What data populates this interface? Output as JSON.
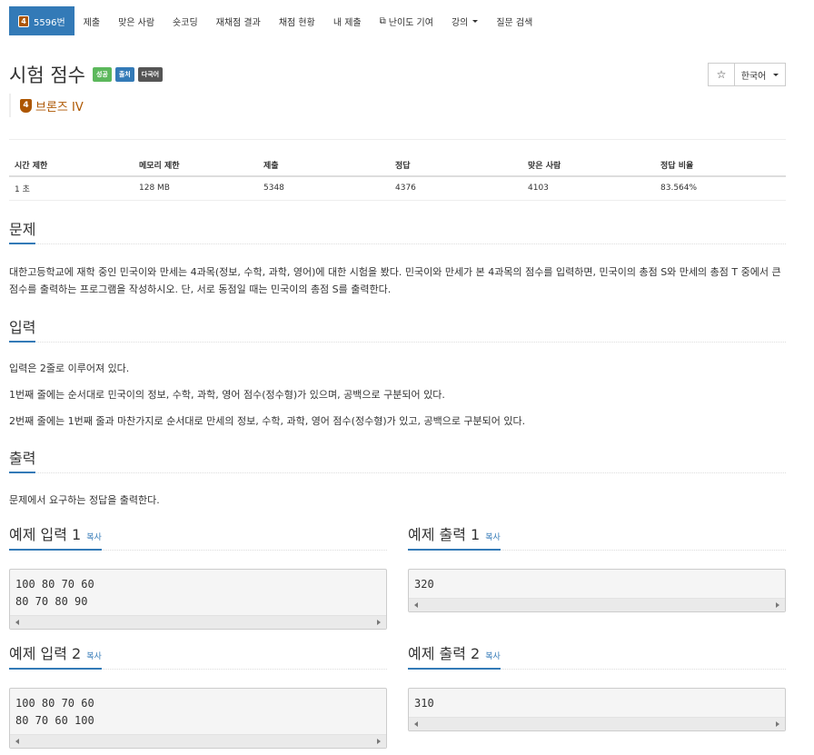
{
  "nav": {
    "active_tier": "4",
    "active_label": "5596번",
    "items": [
      "제출",
      "맞은 사람",
      "숏코딩",
      "재채점 결과",
      "채점 현황",
      "내 제출",
      "난이도 기여",
      "강의",
      "질문 검색"
    ]
  },
  "problem": {
    "title": "시험 점수",
    "labels": [
      "성공",
      "출처",
      "다국어"
    ],
    "tier_num": "4",
    "tier_name": "브론즈 IV"
  },
  "toolbar": {
    "star": "☆",
    "language": "한국어"
  },
  "info": {
    "headers": [
      "시간 제한",
      "메모리 제한",
      "제출",
      "정답",
      "맞은 사람",
      "정답 비율"
    ],
    "values": [
      "1 초",
      "128 MB",
      "5348",
      "4376",
      "4103",
      "83.564%"
    ]
  },
  "sections": {
    "problem_title": "문제",
    "problem_text": "대한고등학교에 재학 중인 민국이와 만세는 4과목(정보, 수학, 과학, 영어)에 대한 시험을 봤다. 민국이와 만세가 본 4과목의 점수를 입력하면, 민국이의 총점 S와 만세의 총점 T 중에서 큰 점수를 출력하는 프로그램을 작성하시오. 단, 서로 동점일 때는 민국이의 총점 S를 출력한다.",
    "input_title": "입력",
    "input_lines": [
      "입력은 2줄로 이루어져 있다.",
      "1번째 줄에는 순서대로 민국이의 정보, 수학, 과학, 영어 점수(정수형)가 있으며, 공백으로 구분되어 있다.",
      "2번째 줄에는 1번째 줄과 마찬가지로 순서대로 만세의 정보, 수학, 과학, 영어 점수(정수형)가 있고, 공백으로 구분되어 있다."
    ],
    "output_title": "출력",
    "output_text": "문제에서 요구하는 정답을 출력한다."
  },
  "samples": {
    "copy_label": "복사",
    "in1_title": "예제 입력 1",
    "in1_text": "100 80 70 60\n80 70 80 90",
    "out1_title": "예제 출력 1",
    "out1_text": "320",
    "in2_title": "예제 입력 2",
    "in2_text": "100 80 70 60\n80 70 60 100",
    "out2_title": "예제 출력 2",
    "out2_text": "310"
  },
  "colors": {
    "primary": "#337ab7",
    "bronze": "#ad5600",
    "success": "#5cb85c"
  }
}
